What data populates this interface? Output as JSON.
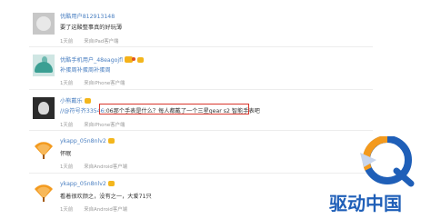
{
  "comments": [
    {
      "username": "优酷用户812913148",
      "text": "要了这酸整事真的好玩薄",
      "time": "1天前",
      "source": "来自iPad客户端"
    },
    {
      "username": "优酷手机用户_48eagojfl",
      "text": "补蛋周补蛋周补蛋周",
      "time": "1天前",
      "source": "来自iPhone客户端"
    },
    {
      "username": "小熊戴乐",
      "text_prefix": "//@符号齐33546",
      "text_highlight": ":06那个手表是什么？每人都戴了一个三星gear s2 智能手表吧",
      "time": "1天前",
      "source": "来自iPhone客户端"
    },
    {
      "username": "ykapp_05n8nlv2",
      "text": "怀眠",
      "time": "1天前",
      "source": "来自Android客户端"
    },
    {
      "username": "ykapp_05n8nlv2",
      "text": "看着很欢颜之，没有之一，大爱71只",
      "time": "1天前",
      "source": "来自Android客户端"
    }
  ],
  "watermark": {
    "text": "驱动中国"
  },
  "colors": {
    "link": "#4a7fc1",
    "highlight_border": "#d8352a",
    "logo_blue": "#1f5fb8",
    "logo_orange": "#f39a1e"
  }
}
